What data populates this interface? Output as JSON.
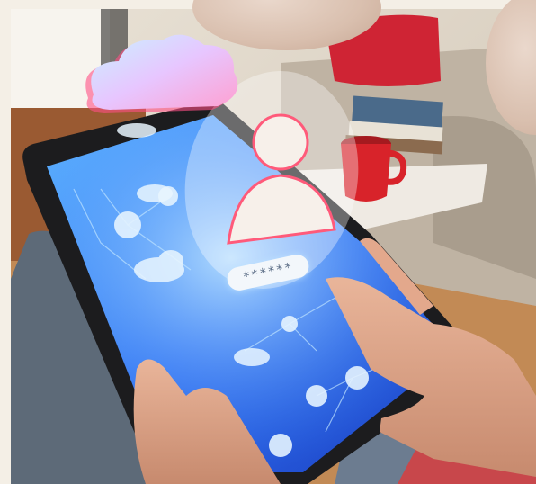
{
  "scene": {
    "description_icons": [
      "cloud-icon",
      "user-icon",
      "network-node-icon"
    ]
  },
  "password_field": {
    "masked_value": "******"
  },
  "colors": {
    "background": "#f4efe6",
    "screen_glow": "#3a8cff",
    "mug": "#d8232a",
    "pillow": "#cf2434"
  }
}
